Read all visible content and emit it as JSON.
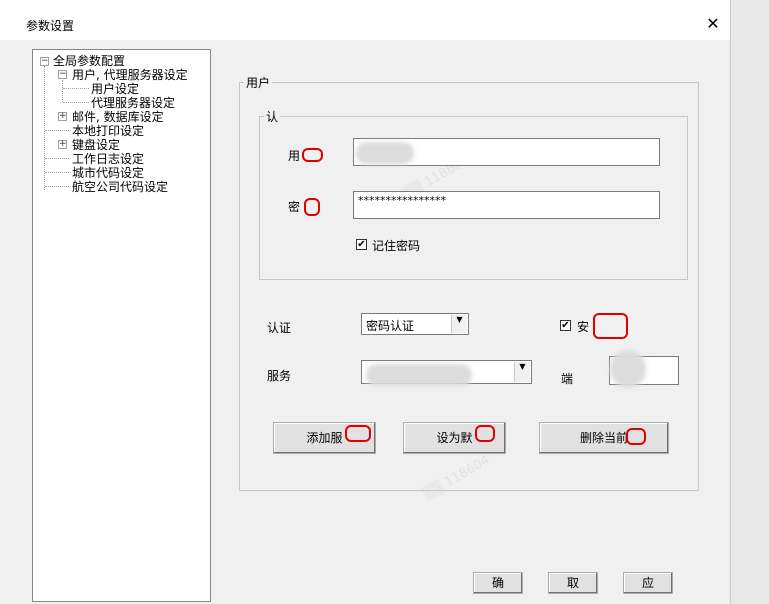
{
  "window": {
    "title": "参数设置",
    "close_glyph": "✕"
  },
  "tree": {
    "root": "全局参数配置",
    "items": [
      "用户, 代理服务器设定",
      "用户设定",
      "代理服务器设定",
      "邮件, 数据库设定",
      "本地打印设定",
      "键盘设定",
      "工作日志设定",
      "城市代码设定",
      "航空公司代码设定"
    ]
  },
  "user_group": {
    "legend": "用户",
    "auth_group": {
      "legend": "认",
      "user_label": "用",
      "user_value": "",
      "password_label": "密",
      "password_value": "****************",
      "remember_checked": true,
      "remember_label": "记住密码"
    },
    "auth_label": "认证",
    "auth_mode": "密码认证",
    "security_checked": true,
    "security_label": "安",
    "server_label": "服务",
    "server_value": "",
    "port_label": "端",
    "port_value": "",
    "buttons": {
      "add": "添加服",
      "set_default": "设为默",
      "delete_current": "删除当前"
    }
  },
  "footer": {
    "ok": "确",
    "cancel": "取",
    "apply": "应"
  }
}
